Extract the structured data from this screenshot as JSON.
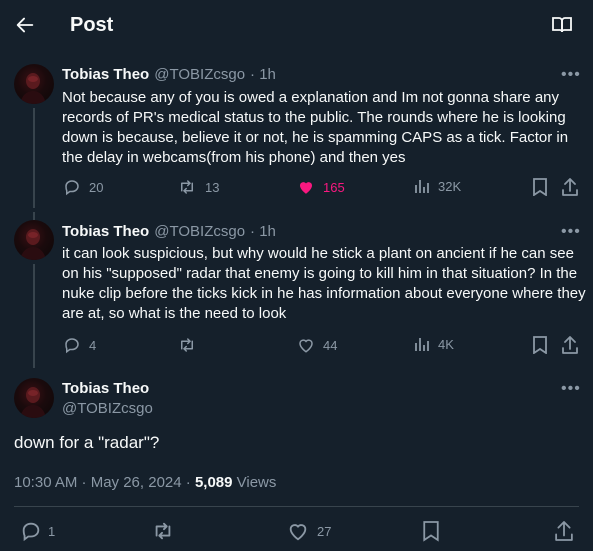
{
  "header": {
    "title": "Post",
    "back_icon": "arrow-left-icon",
    "reader_icon": "book-open-icon"
  },
  "replies": [
    {
      "name": "Tobias Theo",
      "handle": "@TOBIZcsgo",
      "time": "· 1h",
      "text": "Not because any of you is owed a explanation and Im not gonna share any records of PR's medical status to the public. The rounds where he is looking down is because, believe it or not, he is spamming CAPS as a tick. Factor in the delay in webcams(from his phone) and then yes",
      "replies_count": "20",
      "reposts": "13",
      "likes": "165",
      "views": "32K",
      "liked": true
    },
    {
      "name": "Tobias Theo",
      "handle": "@TOBIZcsgo",
      "time": "· 1h",
      "text": "it can look suspicious, but why would he stick a plant on ancient if he can see on his \"supposed\" radar that enemy is going to kill him in that situation? In the nuke clip before the ticks kick in he has information about everyone where they are at, so what is the need to look",
      "replies_count": "4",
      "reposts": "",
      "likes": "44",
      "views": "4K",
      "liked": false
    }
  ],
  "main": {
    "name": "Tobias Theo",
    "handle": "@TOBIZcsgo",
    "text": "down for a \"radar\"?",
    "timestamp": "10:30 AM · May 26, 2024 · ",
    "views_count": "5,089",
    "views_label": " Views",
    "replies_count": "1",
    "reposts": "",
    "likes": "27"
  },
  "colors": {
    "background": "#15202b",
    "text": "#f7f9f9",
    "muted": "#8b98a5",
    "like_pink": "#f91880",
    "divider": "#38444d"
  }
}
